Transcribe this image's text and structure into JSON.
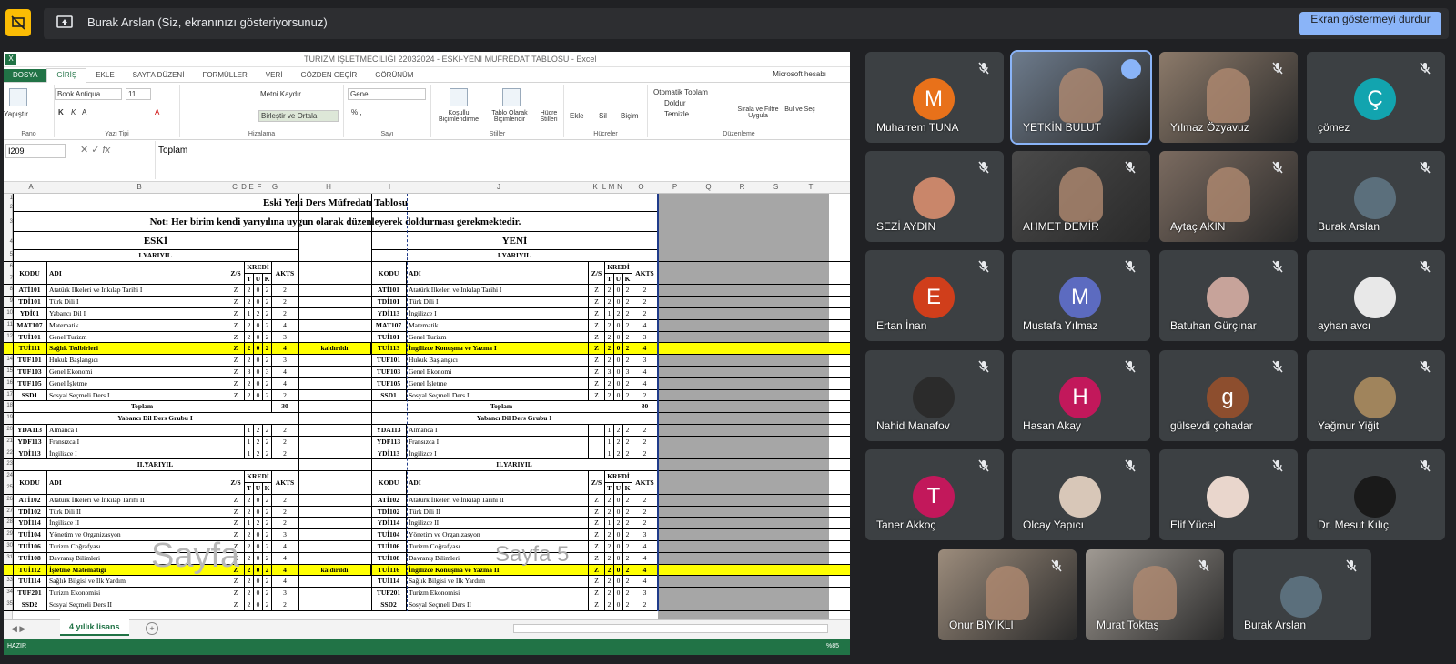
{
  "presenting": {
    "text": "Burak Arslan (Siz, ekranınızı gösteriyorsunuz)",
    "stop_button": "Ekran göstermeyi durdur"
  },
  "excel": {
    "title": "TURİZM İŞLETMECİLİĞİ 22032024 - ESKİ-YENİ MÜFREDAT TABLOSU - Excel",
    "account": "Microsoft hesabı",
    "tabs": [
      "DOSYA",
      "GİRİŞ",
      "EKLE",
      "SAYFA DÜZENİ",
      "FORMÜLLER",
      "VERİ",
      "GÖZDEN GEÇİR",
      "GÖRÜNÜM"
    ],
    "ribbon": {
      "paste": "Yapıştır",
      "font_name": "Book Antiqua",
      "font_size": "11",
      "wrap": "Metni Kaydır",
      "merge": "Birleştir ve Ortala",
      "number_format": "Genel",
      "conditional": "Koşullu Biçimlendirme",
      "table": "Tablo Olarak Biçimlendir",
      "cell_styles": "Hücre Stilleri",
      "insert": "Ekle",
      "delete": "Sil",
      "format": "Biçim",
      "autosum": "Otomatik Toplam",
      "fill": "Doldur",
      "clear": "Temizle",
      "sort": "Sırala ve Filtre Uygula",
      "find": "Bul ve Seç",
      "groups": [
        "Pano",
        "Yazı Tipi",
        "Hizalama",
        "Sayı",
        "Stiller",
        "Hücreler",
        "Düzenleme"
      ]
    },
    "name_box": "I209",
    "formula": "Toplam",
    "columns": [
      "A",
      "B",
      "C",
      "D",
      "E",
      "F",
      "G",
      "H",
      "I",
      "J",
      "K",
      "L",
      "M",
      "N",
      "O",
      "P",
      "Q",
      "R",
      "S",
      "T"
    ],
    "sheet": {
      "title": "Eski Yeni  Ders Müfredatı Tablosu",
      "note": "Not: Her birim kendi yarıyılına uygun olarak düzenleyerek doldurması gerekmektedir.",
      "old_header": "ESKİ",
      "new_header": "YENİ",
      "sem1": "I.YARIYIL",
      "sem2": "II.YARIYIL",
      "h_kodu": "KODU",
      "h_adi": "ADI",
      "h_zs": "Z/S",
      "h_kredi": "KREDİ",
      "h_t": "T",
      "h_u": "U",
      "h_k": "K",
      "h_akts": "AKTS",
      "toplam": "Toplam",
      "toplam_val": "30",
      "foreign": "Yabancı Dil Ders Grubu I",
      "removed": "kaldırıldı",
      "wm1": "Sayfa",
      "wm2": "Sayfa 5",
      "old1": [
        [
          "ATİ101",
          "Atatürk İlkeleri ve İnkılap Tarihi I",
          "Z",
          "2",
          "0",
          "2",
          "2"
        ],
        [
          "TDİ101",
          "Türk Dili I",
          "Z",
          "2",
          "0",
          "2",
          "2"
        ],
        [
          "YDİ01",
          "Yabancı Dil I",
          "Z",
          "1",
          "2",
          "2",
          "2"
        ],
        [
          "MAT107",
          "Matematik",
          "Z",
          "2",
          "0",
          "2",
          "4"
        ],
        [
          "TUİ101",
          "Genel Turizm",
          "Z",
          "2",
          "0",
          "2",
          "3"
        ],
        [
          "TUİ111",
          "Sağlık Tedbirleri",
          "Z",
          "2",
          "0",
          "2",
          "4"
        ],
        [
          "TUF101",
          "Hukuk Başlangıcı",
          "Z",
          "2",
          "0",
          "2",
          "3"
        ],
        [
          "TUF103",
          "Genel Ekonomi",
          "Z",
          "3",
          "0",
          "3",
          "4"
        ],
        [
          "TUF105",
          "Genel İşletme",
          "Z",
          "2",
          "0",
          "2",
          "4"
        ],
        [
          "SSD1",
          "Sosyal Seçmeli Ders I",
          "Z",
          "2",
          "0",
          "2",
          "2"
        ]
      ],
      "new1": [
        [
          "ATİ101",
          "Atatürk İlkeleri ve İnkılap Tarihi I",
          "Z",
          "2",
          "0",
          "2",
          "2"
        ],
        [
          "TDİ101",
          "Türk Dili I",
          "Z",
          "2",
          "0",
          "2",
          "2"
        ],
        [
          "YDİ113",
          "İngilizce I",
          "Z",
          "1",
          "2",
          "2",
          "2"
        ],
        [
          "MAT107",
          "Matematik",
          "Z",
          "2",
          "0",
          "2",
          "4"
        ],
        [
          "TUİ101",
          "Genel Turizm",
          "Z",
          "2",
          "0",
          "2",
          "3"
        ],
        [
          "TUİ113",
          "İngilizce Konuşma ve Yazma I",
          "Z",
          "2",
          "0",
          "2",
          "4"
        ],
        [
          "TUF101",
          "Hukuk Başlangıcı",
          "Z",
          "2",
          "0",
          "2",
          "3"
        ],
        [
          "TUF103",
          "Genel Ekonomi",
          "Z",
          "3",
          "0",
          "3",
          "4"
        ],
        [
          "TUF105",
          "Genel İşletme",
          "Z",
          "2",
          "0",
          "2",
          "4"
        ],
        [
          "SSD1",
          "Sosyal Seçmeli Ders I",
          "Z",
          "2",
          "0",
          "2",
          "2"
        ]
      ],
      "lang": [
        [
          "YDA113",
          "Almanca I",
          "",
          "1",
          "2",
          "2",
          "2"
        ],
        [
          "YDF113",
          "Fransızca I",
          "",
          "1",
          "2",
          "2",
          "2"
        ],
        [
          "YDİ113",
          "İngilizce I",
          "",
          "1",
          "2",
          "2",
          "2"
        ]
      ],
      "old2": [
        [
          "ATİ102",
          "Atatürk İlkeleri ve İnkılap Tarihi II",
          "Z",
          "2",
          "0",
          "2",
          "2"
        ],
        [
          "TDİ102",
          "Türk Dili II",
          "Z",
          "2",
          "0",
          "2",
          "2"
        ],
        [
          "YDİ114",
          "İngilizce II",
          "Z",
          "1",
          "2",
          "2",
          "2"
        ],
        [
          "TUİ104",
          "Yönetim ve Organizasyon",
          "Z",
          "2",
          "0",
          "2",
          "3"
        ],
        [
          "TUİ106",
          "Turizm Coğrafyası",
          "Z",
          "2",
          "0",
          "2",
          "4"
        ],
        [
          "TUİ108",
          "Davranış Bilimleri",
          "Z",
          "2",
          "0",
          "2",
          "4"
        ],
        [
          "TUİ112",
          "İşletme Matematiği",
          "Z",
          "2",
          "0",
          "2",
          "4"
        ],
        [
          "TUİ114",
          "Sağlık Bilgisi ve İlk Yardım",
          "Z",
          "2",
          "0",
          "2",
          "4"
        ],
        [
          "TUF201",
          "Turizm Ekonomisi",
          "Z",
          "2",
          "0",
          "2",
          "3"
        ],
        [
          "SSD2",
          "Sosyal Seçmeli Ders II",
          "Z",
          "2",
          "0",
          "2",
          "2"
        ]
      ],
      "new2": [
        [
          "ATİ102",
          "Atatürk İlkeleri ve İnkılap Tarihi II",
          "Z",
          "2",
          "0",
          "2",
          "2"
        ],
        [
          "TDİ102",
          "Türk Dili II",
          "Z",
          "2",
          "0",
          "2",
          "2"
        ],
        [
          "YDİ114",
          "İngilizce II",
          "Z",
          "1",
          "2",
          "2",
          "2"
        ],
        [
          "TUİ104",
          "Yönetim ve Organizasyon",
          "Z",
          "2",
          "0",
          "2",
          "3"
        ],
        [
          "TUİ106",
          "Turizm Coğrafyası",
          "Z",
          "2",
          "0",
          "2",
          "4"
        ],
        [
          "TUİ108",
          "Davranış Bilimleri",
          "Z",
          "2",
          "0",
          "2",
          "4"
        ],
        [
          "TUİ116",
          "İngilizce Konuşma ve Yazma II",
          "Z",
          "2",
          "0",
          "2",
          "4"
        ],
        [
          "TUİ114",
          "Sağlık Bilgisi ve İlk Yardım",
          "Z",
          "2",
          "0",
          "2",
          "4"
        ],
        [
          "TUF201",
          "Turizm Ekonomisi",
          "Z",
          "2",
          "0",
          "2",
          "3"
        ],
        [
          "SSD2",
          "Sosyal Seçmeli Ders II",
          "Z",
          "2",
          "0",
          "2",
          "2"
        ]
      ]
    },
    "sheet_tab": "4 yıllık lisans",
    "status_ready": "HAZIR",
    "zoom": "%85"
  },
  "participants": [
    {
      "name": "Muharrem TUNA",
      "initial": "M",
      "color": "#e8711a",
      "video": false
    },
    {
      "name": "YETKİN BULUT",
      "initial": "",
      "color": "#6d7b8c",
      "video": true,
      "active": true
    },
    {
      "name": "Yılmaz Özyavuz",
      "initial": "",
      "color": "#8c7a6a",
      "video": true
    },
    {
      "name": "çömez",
      "initial": "Ç",
      "color": "#12a4af",
      "video": false
    },
    {
      "name": "SEZİ AYDIN",
      "initial": "",
      "color": "#c9866a",
      "video": false,
      "photo": true
    },
    {
      "name": "AHMET DEMİR",
      "initial": "",
      "color": "#4a4a4a",
      "video": true
    },
    {
      "name": "Aytaç AKIN",
      "initial": "",
      "color": "#7b6b60",
      "video": true
    },
    {
      "name": "Burak Arslan",
      "initial": "",
      "color": "#5b6f7c",
      "video": false,
      "photo": true
    },
    {
      "name": "Ertan İnan",
      "initial": "E",
      "color": "#d03e1b",
      "video": false
    },
    {
      "name": "Mustafa Yılmaz",
      "initial": "M",
      "color": "#5c6bc0",
      "video": false
    },
    {
      "name": "Batuhan Gürçınar",
      "initial": "",
      "color": "#c7a39a",
      "video": false,
      "photo": true
    },
    {
      "name": "ayhan avcı",
      "initial": "",
      "color": "#e8e8e8",
      "video": false,
      "photo": true
    },
    {
      "name": "Nahid Manafov",
      "initial": "",
      "color": "#2b2b2b",
      "video": false,
      "photo": true
    },
    {
      "name": "Hasan Akay",
      "initial": "H",
      "color": "#c2185b",
      "video": false
    },
    {
      "name": "gülsevdi çohadar",
      "initial": "g",
      "color": "#8d4e2e",
      "video": false
    },
    {
      "name": "Yağmur Yiğit",
      "initial": "",
      "color": "#a0845c",
      "video": false,
      "photo": true
    },
    {
      "name": "Taner Akkoç",
      "initial": "T",
      "color": "#c2185b",
      "video": false
    },
    {
      "name": "Olcay Yapıcı",
      "initial": "",
      "color": "#d8c7b8",
      "video": false,
      "photo": true
    },
    {
      "name": "Elif Yücel",
      "initial": "",
      "color": "#e9d6cc",
      "video": false,
      "photo": true
    },
    {
      "name": "Dr. Mesut Kılıç",
      "initial": "",
      "color": "#1a1a1a",
      "video": false,
      "photo": true
    },
    {
      "name": "Onur BIYIKLI",
      "initial": "",
      "color": "#9c8c7c",
      "video": true
    },
    {
      "name": "Murat Toktaş",
      "initial": "",
      "color": "#a09a93",
      "video": true
    },
    {
      "name": "Burak Arslan",
      "initial": "",
      "color": "#5b6f7c",
      "video": false,
      "photo": true
    }
  ]
}
